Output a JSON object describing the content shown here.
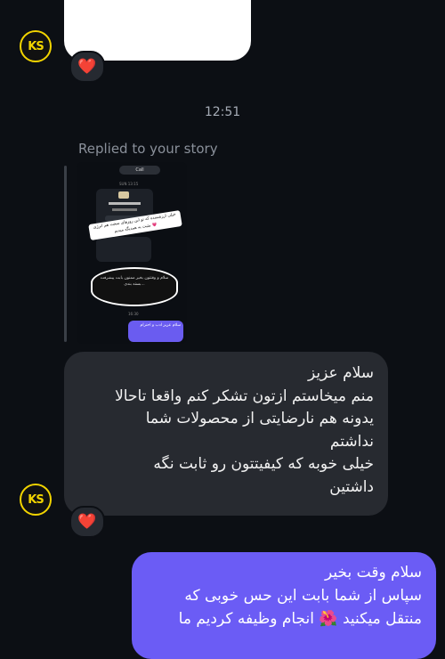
{
  "conversation": {
    "timestamp": "12:51",
    "replied_label": "Replied to your story"
  },
  "avatar": {
    "initials": "KS"
  },
  "reactions": {
    "emoji": "❤️"
  },
  "story_preview": {
    "call_label": "Call",
    "date_label": "SUN 13:15",
    "banner_text": "خیلی ارزشمنده که تو این روزهای سخت هم انرژی مثبت به همدیگه میدیم 💗",
    "dark_bubble_text": "سلام و وقتتون بخیر ممنون بابت پیشرفت بسته بندی...",
    "purple_bubble_text": "سلام عزیز ادب و احترام",
    "time_label": "16:30"
  },
  "incoming_message": {
    "lines": [
      "سلام عزیز",
      "منم میخاستم ازتون تشکر کنم واقعا تاحالا",
      "یدونه هم نارضایتی از محصولات شما",
      "نداشتم",
      "خیلی خوبه که کیفیتتون رو ثابت نگه",
      "داشتین"
    ]
  },
  "outgoing_message": {
    "lines": [
      "سلام وقت بخیر",
      "سپاس از شما بابت این حس خوبی که",
      "منتقل میکنید 🌺 انجام وظیفه کردیم ما"
    ]
  },
  "colors": {
    "background": "#0c0f14",
    "incoming_bubble": "#272a30",
    "outgoing_bubble": "#6b5cf5",
    "avatar_accent": "#f2d400"
  }
}
